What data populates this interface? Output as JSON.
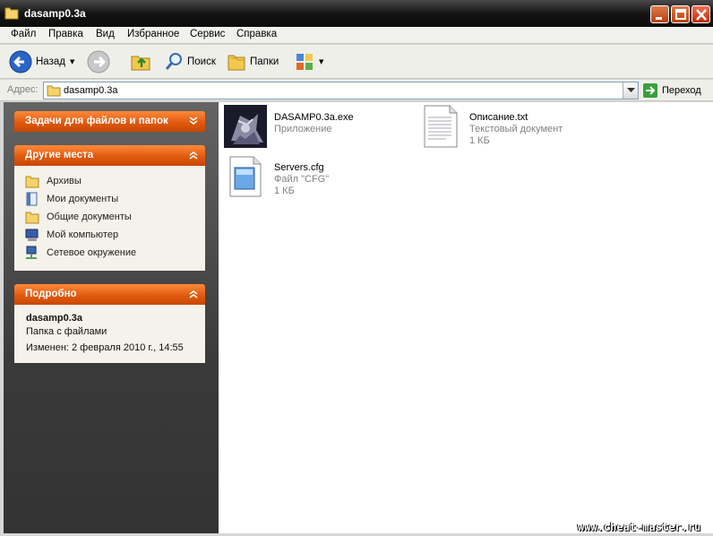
{
  "window": {
    "title": "dasamp0.3a"
  },
  "menu": [
    "Файл",
    "Правка",
    "Вид",
    "Избранное",
    "Сервис",
    "Справка"
  ],
  "toolbar": {
    "back_label": "Назад",
    "search_label": "Поиск",
    "folders_label": "Папки"
  },
  "address": {
    "label": "Адрес:",
    "value": "dasamp0.3a",
    "go_label": "Переход"
  },
  "panels": {
    "tasks": {
      "title": "Задачи для файлов и папок"
    },
    "places": {
      "title": "Другие места",
      "items": [
        {
          "label": "Архивы",
          "icon": "folder-icon"
        },
        {
          "label": "Мои документы",
          "icon": "my-documents-icon"
        },
        {
          "label": "Общие документы",
          "icon": "folder-icon"
        },
        {
          "label": "Мой компьютер",
          "icon": "my-computer-icon"
        },
        {
          "label": "Сетевое окружение",
          "icon": "network-places-icon"
        }
      ]
    },
    "details": {
      "title": "Подробно",
      "name": "dasamp0.3a",
      "type": "Папка с файлами",
      "modified": "Изменен: 2 февраля 2010 г., 14:55"
    }
  },
  "files": [
    {
      "name": "DASAMP0.3a.exe",
      "line2": "Приложение",
      "line3": "",
      "icon": "exe-icon"
    },
    {
      "name": "Описание.txt",
      "line2": "Текстовый документ",
      "line3": "1 КБ",
      "icon": "text-file-icon"
    },
    {
      "name": "Servers.cfg",
      "line2": "Файл \"CFG\"",
      "line3": "1 КБ",
      "icon": "cfg-file-icon"
    }
  ],
  "watermark": "www.cheat-master.ru",
  "colors": {
    "panel_header": "#e05a10",
    "title_bar": "#141414",
    "pane_bg": "#3a3a3a"
  }
}
